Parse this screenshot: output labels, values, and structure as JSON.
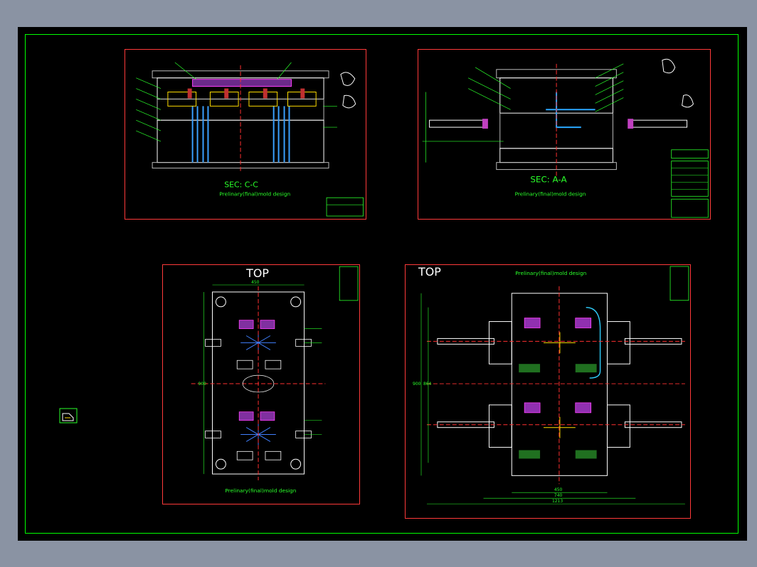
{
  "viewer": {
    "background_color": "#000000",
    "frame_color": "#00ff00",
    "sheet_border_color": "#ff3a3a"
  },
  "sheets": {
    "sec_cc": {
      "section_label": "SEC: C-C",
      "caption": "Prelinary(final)mold design"
    },
    "sec_aa": {
      "section_label": "SEC: A-A",
      "caption": "Prelinary(final)mold design"
    },
    "top_left": {
      "view_label": "TOP",
      "caption": "Prelinary(final)mold design",
      "dims": {
        "width": "450",
        "height": "900"
      }
    },
    "top_right": {
      "view_label": "TOP",
      "caption": "Prelinary(final)mold design",
      "dims": {
        "d1": "450",
        "d2": "740",
        "d3": "1213",
        "h1": "900",
        "h2": "864"
      }
    }
  },
  "icons": {
    "view_cube": "view-cube-icon"
  }
}
